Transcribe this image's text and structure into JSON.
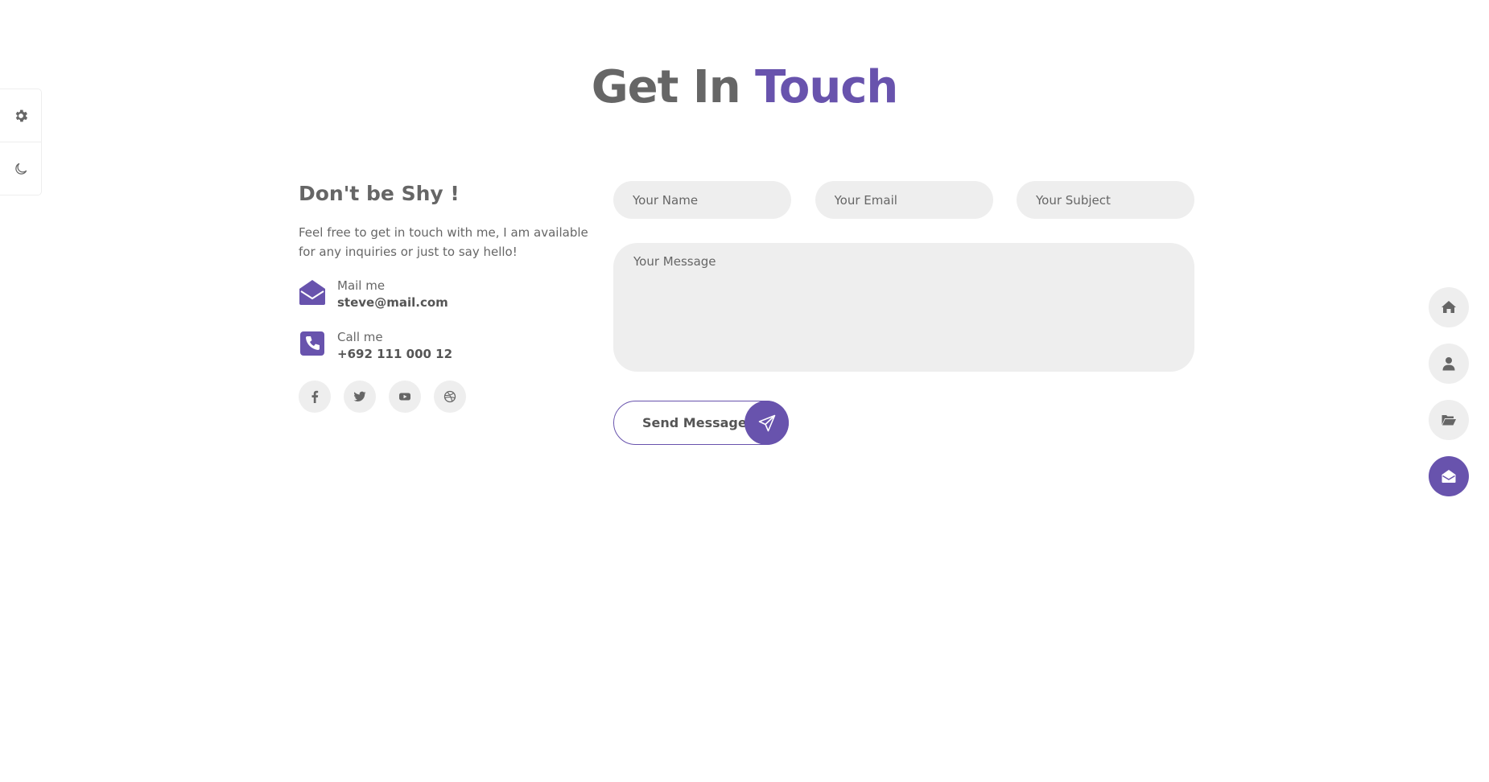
{
  "heading": {
    "part1": "Get In",
    "part2": "Touch"
  },
  "colors": {
    "accent": "#6853ad",
    "text": "#666666",
    "field_bg": "#eeeeee"
  },
  "side_tools": [
    {
      "icon": "gear-icon"
    },
    {
      "icon": "moon-icon"
    }
  ],
  "info": {
    "title": "Don't be Shy !",
    "description": "Feel free to get in touch with me, I am available for any inquiries or just to say hello!",
    "mail": {
      "label": "Mail me",
      "value": "steve@mail.com",
      "icon": "envelope-open-icon"
    },
    "phone": {
      "label": "Call me",
      "value": "+692 111 000 12",
      "icon": "phone-icon"
    },
    "socials": [
      "facebook-icon",
      "twitter-icon",
      "youtube-icon",
      "dribbble-icon"
    ]
  },
  "form": {
    "name_placeholder": "Your Name",
    "email_placeholder": "Your Email",
    "subject_placeholder": "Your Subject",
    "message_placeholder": "Your Message",
    "send_label": "Send Message"
  },
  "right_nav": [
    {
      "icon": "home-icon",
      "active": false
    },
    {
      "icon": "user-icon",
      "active": false
    },
    {
      "icon": "folder-open-icon",
      "active": false
    },
    {
      "icon": "envelope-open-icon",
      "active": true
    }
  ]
}
